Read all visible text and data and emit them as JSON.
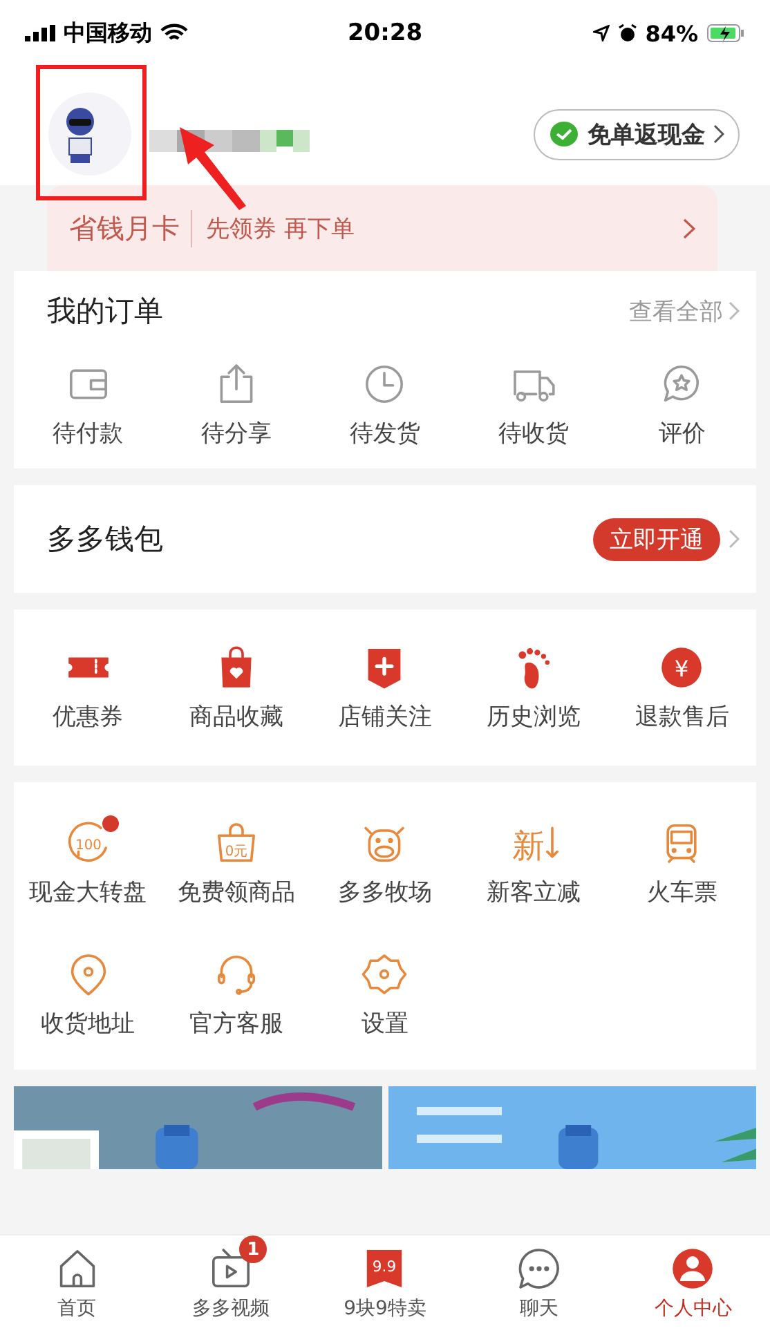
{
  "status_bar": {
    "carrier": "中国移动",
    "time": "20:28",
    "battery": "84%"
  },
  "header": {
    "cashback_button": "免单返现金"
  },
  "promo_card": {
    "title": "省钱月卡",
    "subtitle": "先领券 再下单"
  },
  "orders": {
    "title": "我的订单",
    "view_all": "查看全部",
    "items": [
      {
        "kind": "wallet",
        "label": "待付款"
      },
      {
        "kind": "share",
        "label": "待分享"
      },
      {
        "kind": "clock",
        "label": "待发货"
      },
      {
        "kind": "truck",
        "label": "待收货"
      },
      {
        "kind": "review",
        "label": "评价"
      }
    ]
  },
  "wallet": {
    "title": "多多钱包",
    "button": "立即开通"
  },
  "tools": [
    {
      "kind": "ticket",
      "label": "优惠券"
    },
    {
      "kind": "bag-heart",
      "label": "商品收藏"
    },
    {
      "kind": "shop",
      "label": "店铺关注"
    },
    {
      "kind": "foot",
      "label": "历史浏览"
    },
    {
      "kind": "yen",
      "icon_text": "¥",
      "label": "退款售后"
    }
  ],
  "services": [
    {
      "kind": "wheel",
      "icon_text": "100",
      "label": "现金大转盘",
      "dot": true
    },
    {
      "kind": "bag-text",
      "icon_text": "0元",
      "label": "免费领商品",
      "dot": false
    },
    {
      "kind": "cow",
      "label": "多多牧场",
      "dot": false
    },
    {
      "kind": "new",
      "icon_text": "新",
      "label": "新客立减",
      "dot": false
    },
    {
      "kind": "train",
      "label": "火车票",
      "dot": false
    },
    {
      "kind": "pin",
      "label": "收货地址",
      "dot": false
    },
    {
      "kind": "headset",
      "label": "官方客服",
      "dot": false
    },
    {
      "kind": "gear",
      "label": "设置",
      "dot": false
    }
  ],
  "tab_bar": [
    {
      "kind": "home",
      "label": "首页",
      "selected": false
    },
    {
      "kind": "tv",
      "label": "多多视频",
      "badge": "1",
      "selected": false
    },
    {
      "kind": "tag",
      "icon_text": "9.9",
      "label": "9块9特卖",
      "selected": false
    },
    {
      "kind": "chat",
      "label": "聊天",
      "selected": false
    },
    {
      "kind": "person",
      "label": "个人中心",
      "selected": true
    }
  ]
}
